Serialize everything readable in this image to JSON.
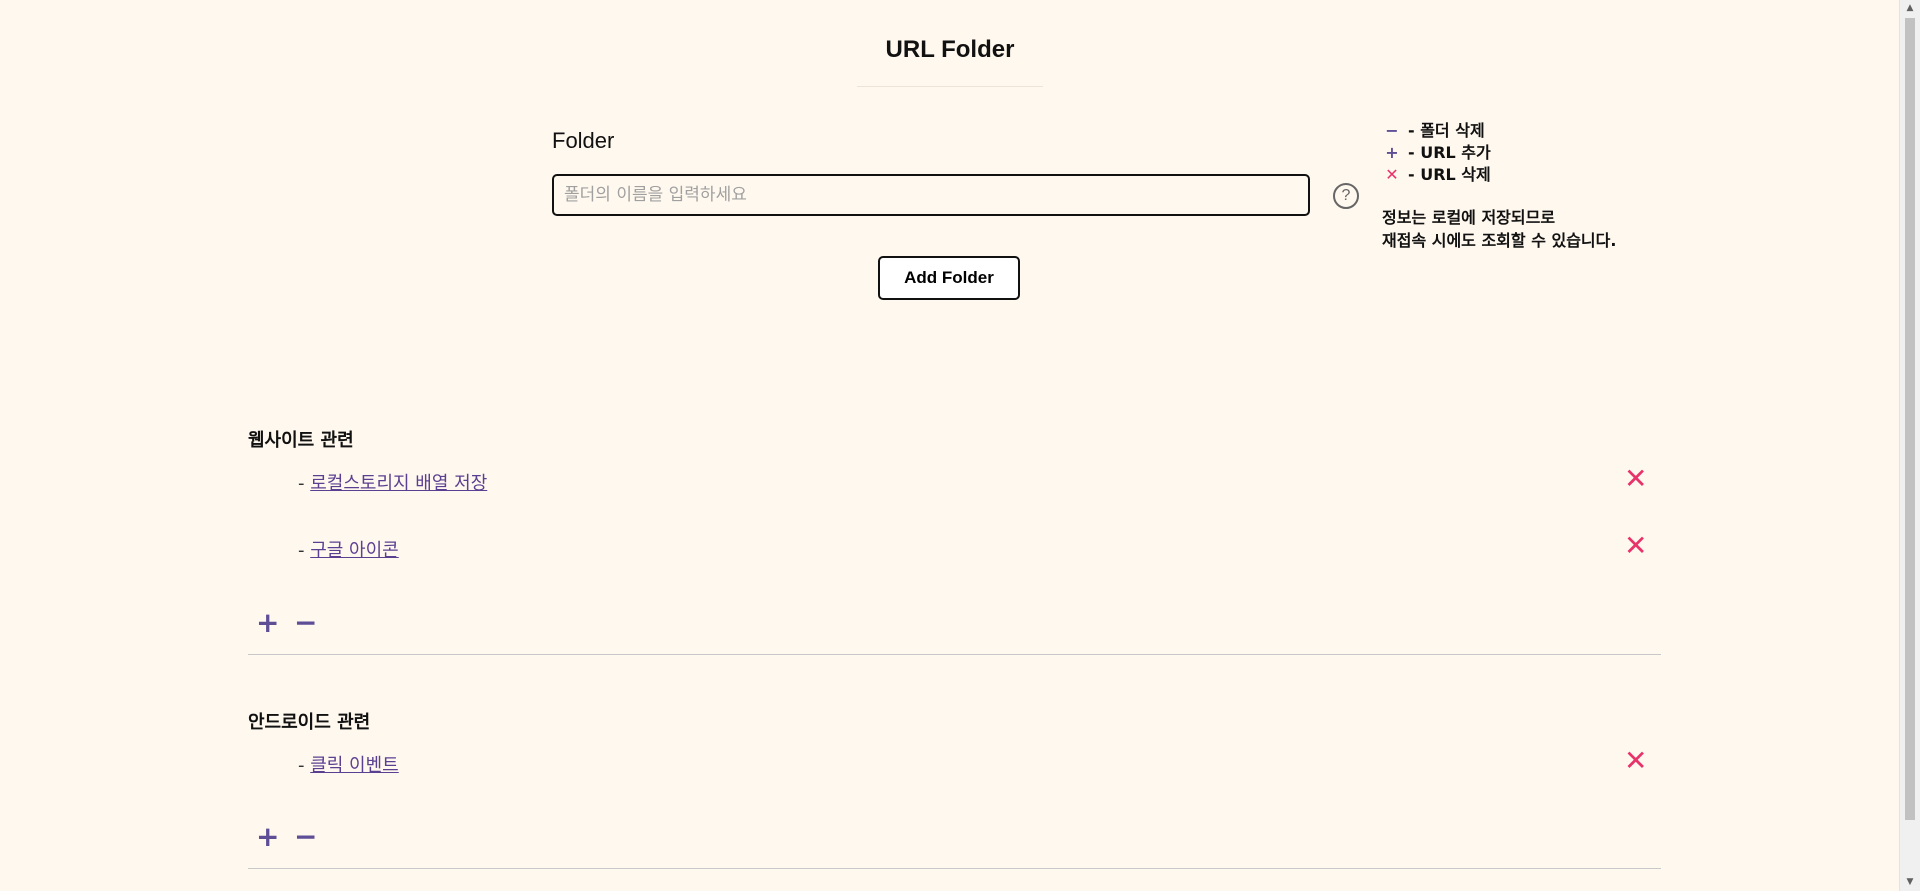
{
  "header": {
    "title": "URL Folder"
  },
  "form": {
    "folder_label": "Folder",
    "input_placeholder": "폴더의 이름을 입력하세요",
    "input_value": "",
    "add_button_label": "Add Folder",
    "help_icon": "?"
  },
  "legend": {
    "items": [
      {
        "icon": "minus-icon",
        "glyph": "−",
        "text": "- 폴더 삭제"
      },
      {
        "icon": "plus-icon",
        "glyph": "+",
        "text": "- URL 추가"
      },
      {
        "icon": "x-icon",
        "glyph": "✕",
        "text": "- URL 삭제"
      }
    ],
    "info_line1": "정보는 로컬에 저장되므로",
    "info_line2": "재접속 시에도 조회할 수 있습니다."
  },
  "folders": [
    {
      "name": "웹사이트 관련",
      "urls": [
        {
          "prefix": "- ",
          "label": "로컬스토리지 배열 저장"
        },
        {
          "prefix": "- ",
          "label": "구글 아이콘"
        }
      ]
    },
    {
      "name": "안드로이드 관련",
      "urls": [
        {
          "prefix": "- ",
          "label": "클릭 이벤트"
        }
      ]
    }
  ],
  "icons": {
    "add_url": "+",
    "delete_folder": "−",
    "delete_url": "✕"
  },
  "colors": {
    "background": "#fff8ee",
    "accent_purple": "#5d4e96",
    "delete_pink": "#e8336a",
    "link": "#5b3f91"
  }
}
